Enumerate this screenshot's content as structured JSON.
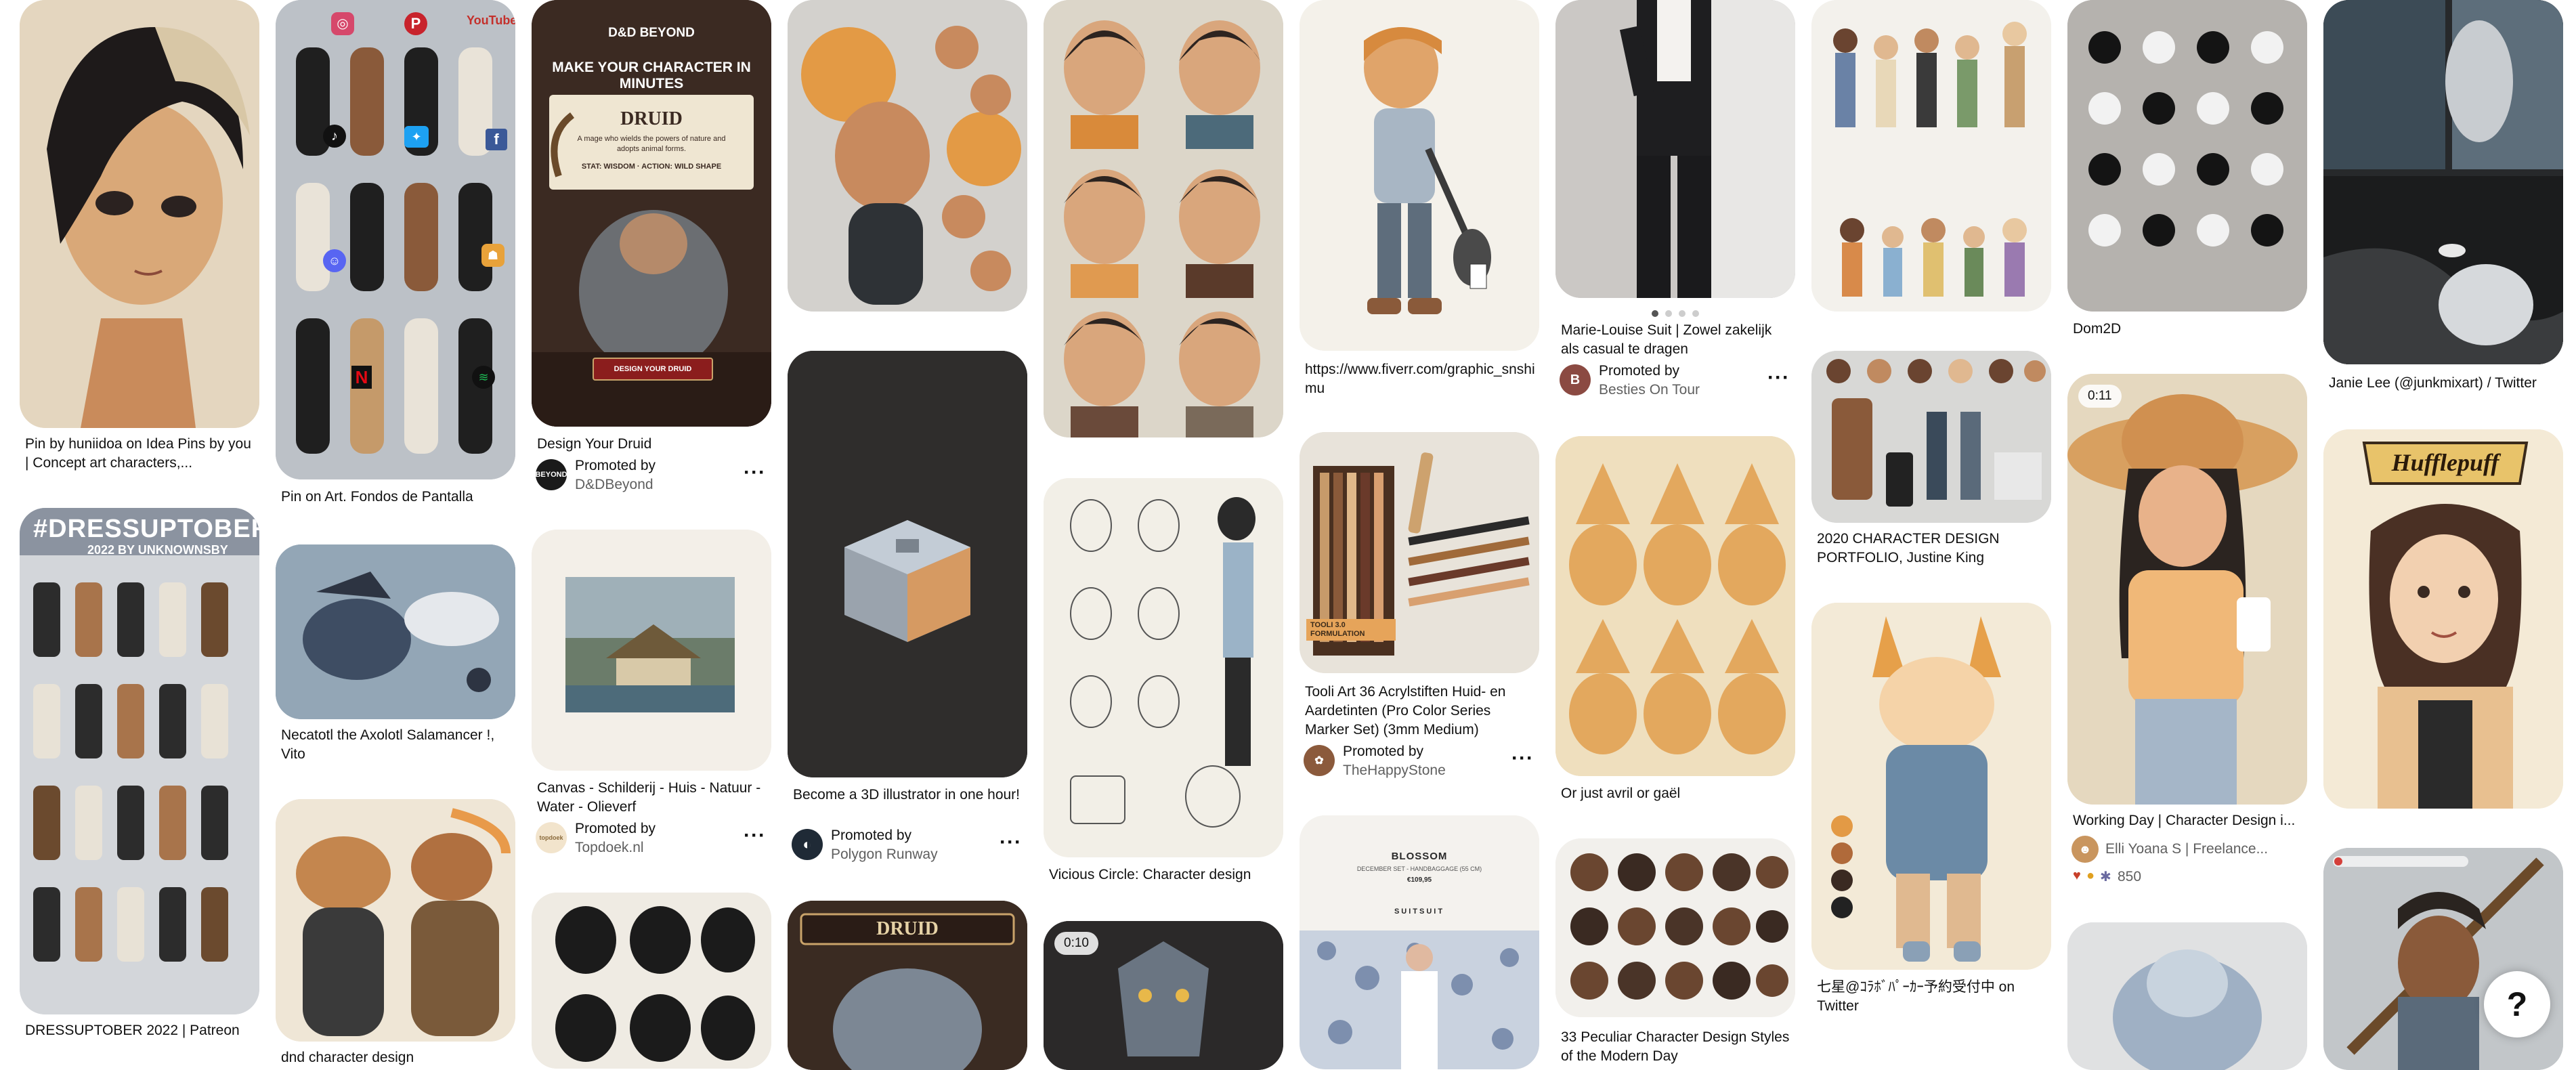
{
  "pins": [
    {
      "caption": "Pin by huniidoa on Idea Pins by you | Concept art characters,...",
      "bg": "#dcc7a8",
      "art": "boy with dark hair portrait"
    },
    {
      "caption": "DRESSUPTOBER 2022 | Patreon",
      "bg": "#cfd3d8",
      "overlay": "#DRESSUPTOBER",
      "overlay2": "2022 BY UNKNOWNSBY"
    },
    {
      "caption": "Pin on Art. Fondos de Pantalla",
      "bg": "#b9bec4",
      "icons": [
        "instagram-icon",
        "pinterest-icon",
        "youtube-icon",
        "tiktok-icon",
        "twitter-icon",
        "facebook-icon",
        "discord-icon",
        "netflix-icon",
        "spotify-icon",
        "snapchat-icon"
      ],
      "youtube": "YouTube"
    },
    {
      "caption": "Necatotl the Axolotl Salamancer !, Vito",
      "bg": "#8fa2b3"
    },
    {
      "caption": "dnd character design",
      "bg": "#efe6d6"
    },
    {
      "caption": "Design Your Druid",
      "bg": "#3e2a22",
      "logo": "D&D BEYOND",
      "headline": "MAKE YOUR CHARACTER IN MINUTES",
      "card_title": "DRUID",
      "card_text": "A mage who wields the powers of nature and adopts animal forms.",
      "card_stat": "STAT: WISDOM · ACTION: WILD SHAPE",
      "cta": "DESIGN YOUR DRUID",
      "promoted": "Promoted by",
      "advertiser": "D&DBeyond",
      "avatar_text": "BEYOND"
    },
    {
      "caption": "Canvas - Schilderij - Huis - Natuur - Water - Olieverf",
      "bg": "#f1ede6",
      "promoted": "Promoted by",
      "advertiser": "Topdoek.nl",
      "avatar_text": "topdoek"
    },
    {
      "caption": "",
      "bg": "#eeeae2"
    },
    {
      "caption": "",
      "bg": "#d5d3cf"
    },
    {
      "caption": "Become a 3D illustrator in one hour!",
      "bg": "#2e2c2b",
      "promoted": "Promoted by",
      "advertiser": "Polygon Runway"
    },
    {
      "caption": "",
      "bg": "#3a2b22",
      "card_title": "DRUID"
    },
    {
      "caption": "",
      "bg": "#d7d2c6"
    },
    {
      "caption": "Vicious Circle: Character design",
      "bg": "#f2efe8"
    },
    {
      "caption": "",
      "bg": "#2a2828",
      "badge": "0:10"
    },
    {
      "caption": "https://www.fiverr.com/graphic_snshimu",
      "bg": "#f4f1ea"
    },
    {
      "caption": "Tooli Art 36 Acrylstiften Huid- en Aardetinten (Pro Color Series Marker Set) (3mm Medium)",
      "bg": "#e9e5dd",
      "promoted": "Promoted by",
      "advertiser": "TheHappyStone",
      "tag": "TOOLI 3.0 FORMULATION"
    },
    {
      "caption": "",
      "bg": "#f4f2ee",
      "brand": "BLOSSOM",
      "sub": "DECEMBER SET - HANDBAGGAGE (55 CM)",
      "price": "€109,95",
      "logo": "SUITSUIT"
    },
    {
      "caption": "Marie-Louise Suit | Zowel zakelijk als casual te dragen",
      "bg": "#c9c6c3",
      "promoted": "Promoted by",
      "advertiser": "Besties On Tour"
    },
    {
      "caption": "Or just avril or gaël",
      "bg": "#efe0c0"
    },
    {
      "caption": "33 Peculiar Character Design Styles of the Modern Day",
      "bg": "#f2f0ec"
    },
    {
      "caption": "",
      "bg": "#f3f1ec"
    },
    {
      "caption": "2020 CHARACTER DESIGN PORTFOLIO, Justine King",
      "bg": "#d9d9d9"
    },
    {
      "caption": "七星@ｺﾗﾎﾞﾊﾟｰｶｰ予約受付中 on Twitter",
      "bg": "#f4ecd9"
    },
    {
      "caption": "Dom2D",
      "bg": "#b4b2ae"
    },
    {
      "caption": "Working Day | Character Design i...",
      "bg": "#e6d9c0",
      "badge": "0:11",
      "author": "Elli Yoana S | Freelance...",
      "reaction_count": "850"
    },
    {
      "caption": "",
      "bg": "#dfe0e0"
    },
    {
      "caption": "Janie Lee (@junkmixart) / Twitter",
      "bg": "#26282a"
    },
    {
      "caption": "",
      "bg": "#f3ead8",
      "title": "Hufflepuff"
    },
    {
      "caption": "",
      "bg": "#bfc3c6"
    }
  ],
  "help_label": "?"
}
